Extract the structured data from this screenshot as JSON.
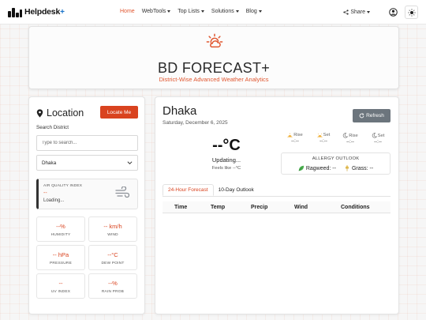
{
  "nav": {
    "brand": "Helpdesk",
    "brand_plus": "+",
    "links": [
      {
        "label": "Home",
        "active": true,
        "dropdown": false
      },
      {
        "label": "WebTools",
        "active": false,
        "dropdown": true
      },
      {
        "label": "Top Lists",
        "active": false,
        "dropdown": true
      },
      {
        "label": "Solutions",
        "active": false,
        "dropdown": true
      },
      {
        "label": "Blog",
        "active": false,
        "dropdown": true
      }
    ],
    "share_label": "Share",
    "user_icon": "user-circle-icon",
    "theme_icon": "sun-icon"
  },
  "hero": {
    "icon": "sun-cloud-icon",
    "title": "BD FORECAST+",
    "subtitle": "District-Wise Advanced Weather Analytics"
  },
  "location": {
    "title": "Location",
    "locate_button": "Locate Me",
    "search_label": "Search District",
    "search_placeholder": "Type to search...",
    "selected_district": "Dhaka"
  },
  "aqi": {
    "label": "AIR QUALITY INDEX",
    "value": "--",
    "status": "Loading..."
  },
  "metrics": [
    {
      "value": "--%",
      "label": "HUMIDITY"
    },
    {
      "value": "-- km/h",
      "label": "WIND"
    },
    {
      "value": "-- hPa",
      "label": "PRESSURE"
    },
    {
      "value": "--°C",
      "label": "DEW POINT"
    },
    {
      "value": "--",
      "label": "UV INDEX"
    },
    {
      "value": "--%",
      "label": "RAIN PROB"
    }
  ],
  "weather": {
    "city": "Dhaka",
    "date": "Saturday, December 6, 2025",
    "refresh_button": "Refresh",
    "temp": "--°C",
    "status": "Updating...",
    "feels_like": "Feels like --°C"
  },
  "astro": [
    {
      "label": "Rise",
      "value": "--:--",
      "icon": "sunrise-icon"
    },
    {
      "label": "Set",
      "value": "--:--",
      "icon": "sunset-icon"
    },
    {
      "label": "Rise",
      "value": "--:--",
      "icon": "moonrise-icon"
    },
    {
      "label": "Set",
      "value": "--:--",
      "icon": "moonset-icon"
    }
  ],
  "allergy": {
    "title": "ALLERGY OUTLOOK",
    "ragweed": "Ragweed: --",
    "grass": "Grass: --"
  },
  "forecast": {
    "tabs": [
      "24-Hour Forecast",
      "10-Day Outlook"
    ],
    "columns": [
      "Time",
      "Temp",
      "Precip",
      "Wind",
      "Conditions"
    ]
  },
  "colors": {
    "accent": "#d9431f",
    "secondary_button": "#6c757d"
  }
}
